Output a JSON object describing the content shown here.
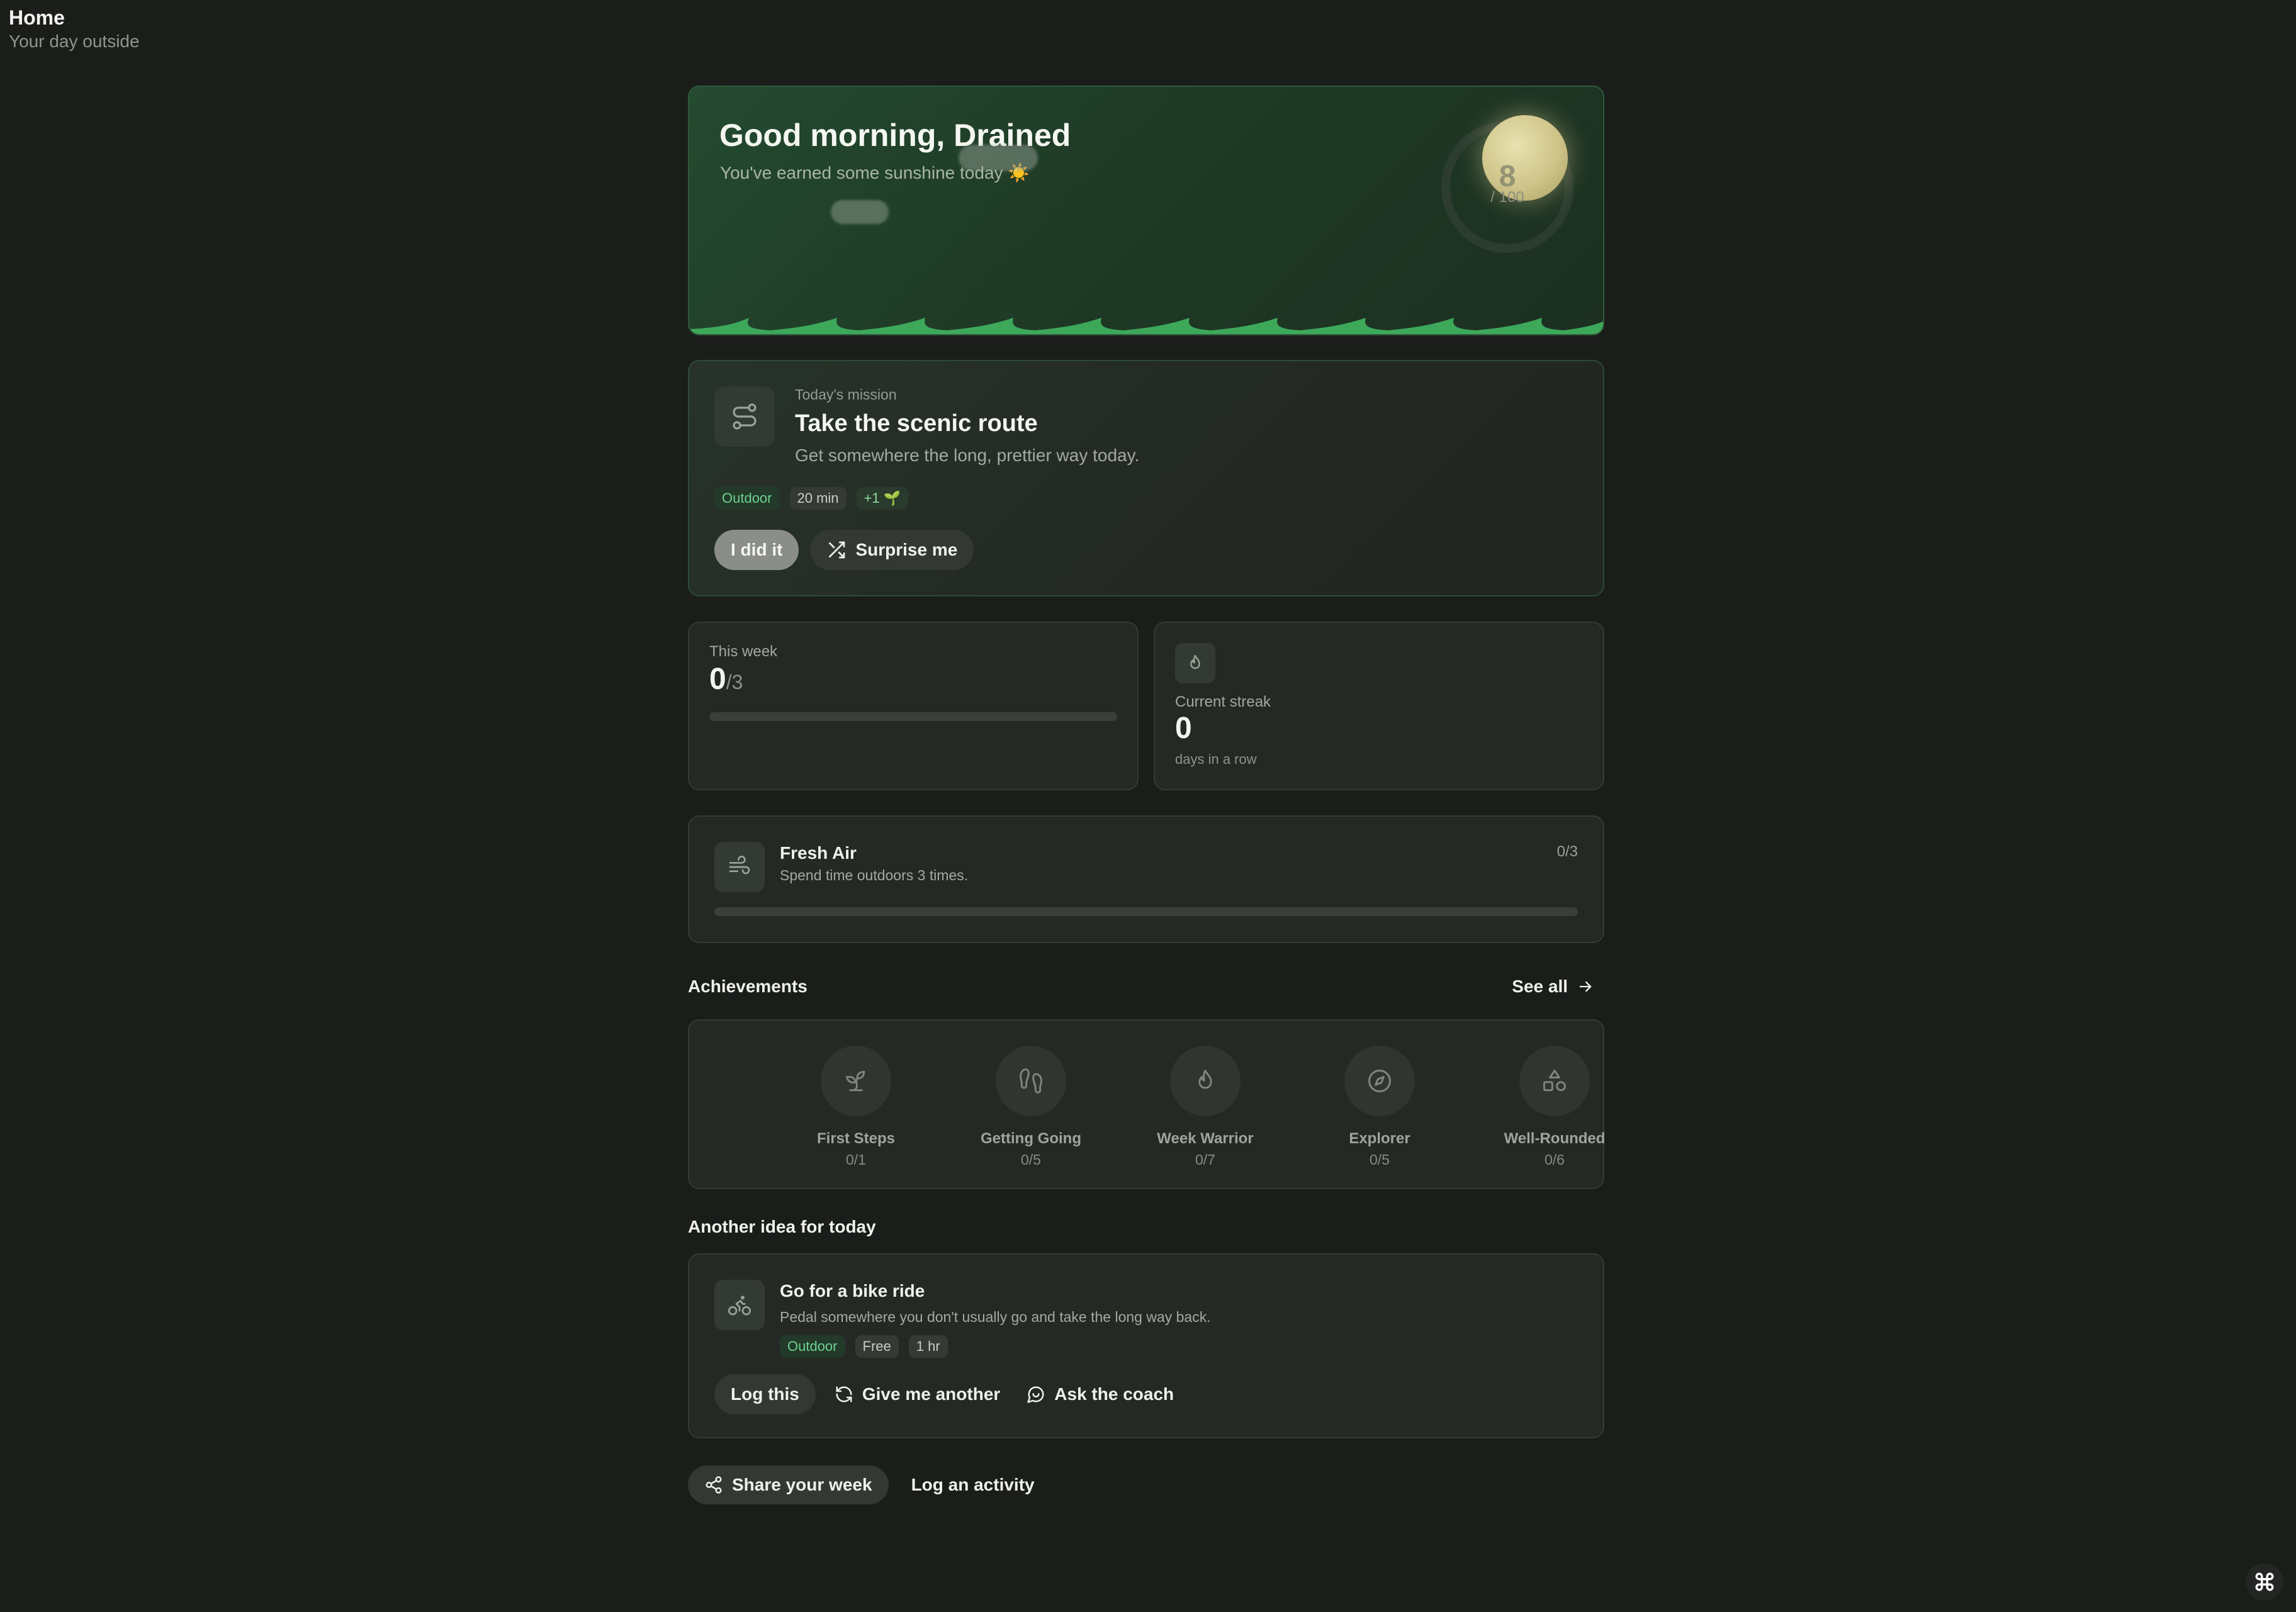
{
  "header": {
    "title": "Home",
    "subtitle": "Your day outside"
  },
  "hero": {
    "greeting": "Good morning, Drained",
    "subtitle": "You've earned some sunshine today",
    "score": "8",
    "score_max": "/ 100",
    "score_fraction": 0.08
  },
  "mission": {
    "eyebrow": "Today's mission",
    "title": "Take the scenic route",
    "description": "Get somewhere the long, prettier way today.",
    "chips": [
      "Outdoor",
      "20 min",
      "+1"
    ],
    "done_label": "I did it",
    "surprise_label": "Surprise me"
  },
  "stats": {
    "week_label": "This week",
    "week_value": "0",
    "week_goal": "/3",
    "week_progress": 0,
    "streak_label": "Current streak",
    "streak_value": "0",
    "streak_sub": "days in a row"
  },
  "challenge": {
    "title": "Fresh Air",
    "description": "Spend time outdoors 3 times.",
    "count": "0/3",
    "progress": 0
  },
  "achievements": {
    "title": "Achievements",
    "see_all": "See all",
    "items": [
      {
        "name": "First Steps",
        "progress": "0/1"
      },
      {
        "name": "Getting Going",
        "progress": "0/5"
      },
      {
        "name": "Week Warrior",
        "progress": "0/7"
      },
      {
        "name": "Explorer",
        "progress": "0/5"
      },
      {
        "name": "Well-Rounded",
        "progress": "0/6"
      }
    ]
  },
  "idea": {
    "section_title": "Another idea for today",
    "title": "Go for a bike ride",
    "description": "Pedal somewhere you don't usually go and take the long way back.",
    "chips": [
      "Outdoor",
      "Free",
      "1 hr"
    ],
    "log_label": "Log this",
    "another_label": "Give me another",
    "coach_label": "Ask the coach"
  },
  "footer": {
    "share_label": "Share your week",
    "log_label": "Log an activity"
  },
  "colors": {
    "background": "#1a1d1a",
    "accent": "#5fc47c",
    "card": "#252925"
  }
}
